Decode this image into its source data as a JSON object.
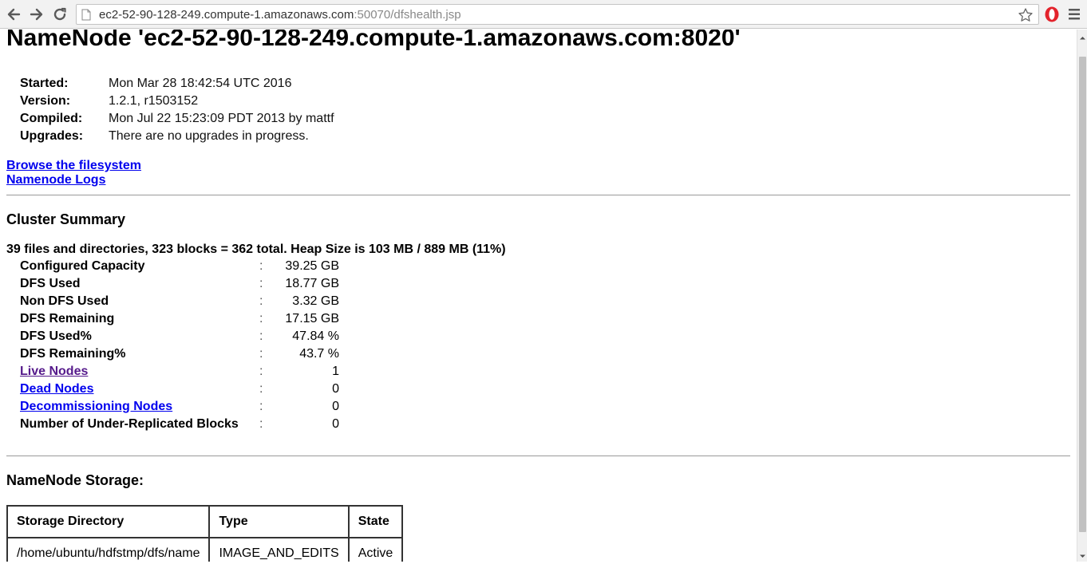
{
  "browser": {
    "url_host": "ec2-52-90-128-249.compute-1.amazonaws.com",
    "url_path": ":50070/dfshealth.jsp"
  },
  "page": {
    "title": "NameNode 'ec2-52-90-128-249.compute-1.amazonaws.com:8020'"
  },
  "info": [
    {
      "label": "Started:",
      "value": "Mon Mar 28 18:42:54 UTC 2016"
    },
    {
      "label": "Version:",
      "value": "1.2.1, r1503152"
    },
    {
      "label": "Compiled:",
      "value": "Mon Jul 22 15:23:09 PDT 2013 by mattf"
    },
    {
      "label": "Upgrades:",
      "value": "There are no upgrades in progress."
    }
  ],
  "links": {
    "browse": "Browse the filesystem",
    "logs": "Namenode Logs"
  },
  "cluster_summary": {
    "title": "Cluster Summary",
    "summary_line": "39 files and directories, 323 blocks = 362 total. Heap Size is 103 MB / 889 MB (11%)",
    "colon": ":",
    "rows": [
      {
        "label": "Configured Capacity",
        "value": "39.25 GB"
      },
      {
        "label": "DFS Used",
        "value": "18.77 GB"
      },
      {
        "label": "Non DFS Used",
        "value": "3.32 GB"
      },
      {
        "label": "DFS Remaining",
        "value": "17.15 GB"
      },
      {
        "label": "DFS Used%",
        "value": "47.84 %"
      },
      {
        "label": "DFS Remaining%",
        "value": "43.7 %"
      },
      {
        "label": "Live Nodes",
        "value": "1"
      },
      {
        "label": "Dead Nodes",
        "value": "0"
      },
      {
        "label": "Decommissioning Nodes",
        "value": "0"
      },
      {
        "label": "Number of Under-Replicated Blocks",
        "value": "0"
      }
    ]
  },
  "storage": {
    "title": "NameNode Storage:",
    "headers": [
      "Storage Directory",
      "Type",
      "State"
    ],
    "rows": [
      [
        "/home/ubuntu/hdfstmp/dfs/name",
        "IMAGE_AND_EDITS",
        "Active"
      ]
    ]
  }
}
